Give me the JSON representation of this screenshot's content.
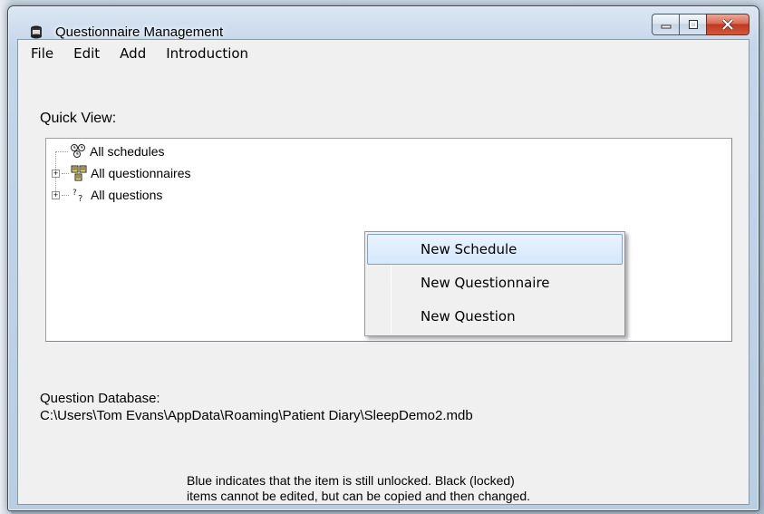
{
  "window": {
    "title": "Questionnaire Management",
    "app_icon": "filter-drum-icon",
    "buttons": {
      "minimize": "minimize-icon",
      "maximize": "maximize-icon",
      "close": "close-icon"
    }
  },
  "menubar": {
    "items": [
      {
        "label": "File"
      },
      {
        "label": "Edit"
      },
      {
        "label": "Add"
      },
      {
        "label": "Introduction"
      }
    ]
  },
  "quick_view": {
    "label": "Quick View:",
    "tree": [
      {
        "label": "All schedules",
        "icon": "schedules-icon",
        "expandable": false
      },
      {
        "label": "All questionnaires",
        "icon": "questionnaires-icon",
        "expandable": true
      },
      {
        "label": "All questions",
        "icon": "question-marks-icon",
        "expandable": true
      }
    ]
  },
  "database": {
    "label": "Question Database:",
    "path": "C:\\Users\\Tom Evans\\AppData\\Roaming\\Patient Diary\\SleepDemo2.mdb"
  },
  "note": {
    "line1": "Blue indicates that the item is still unlocked.  Black (locked)",
    "line2": "items cannot be edited, but can be copied and then changed."
  },
  "context_menu": {
    "items": [
      {
        "label": "New Schedule",
        "highlighted": true
      },
      {
        "label": "New Questionnaire",
        "highlighted": false
      },
      {
        "label": "New Question",
        "highlighted": false
      }
    ]
  },
  "colors": {
    "highlight": "#d5e8fb",
    "highlight_border": "#7da2ce",
    "close_button": "#c0391f",
    "client_bg": "#f0f0f0"
  }
}
